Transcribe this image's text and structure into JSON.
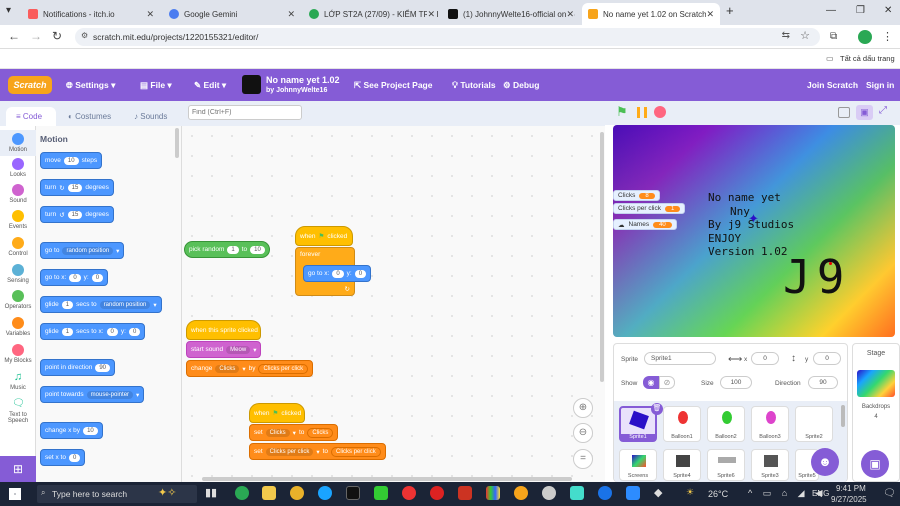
{
  "browser": {
    "tabs": [
      {
        "title": "Notifications - itch.io",
        "color": "#fa5c5c"
      },
      {
        "title": "Google Gemini",
        "color": "#4a7cf0"
      },
      {
        "title": "LỚP ST2A (27/09) - KIỂM TRA I",
        "color": "#2aa854"
      },
      {
        "title": "(1) JohnnyWelte16-official on G",
        "color": "#111111"
      },
      {
        "title": "No name yet 1.02 on Scratch",
        "color": "#f7a41b"
      }
    ],
    "url": "scratch.mit.edu/projects/1220155321/editor/",
    "bookmarks_folder": "Tất cả dấu trang"
  },
  "menubar": {
    "logo": "Scratch",
    "settings": "Settings",
    "file": "File",
    "edit": "Edit",
    "project_title": "No name yet 1.02",
    "project_author": "by JohnnyWelte16",
    "see_project_page": "See Project Page",
    "tutorials": "Tutorials",
    "debug": "Debug",
    "join": "Join Scratch",
    "signin": "Sign in"
  },
  "editor_tabs": {
    "code": "Code",
    "costumes": "Costumes",
    "sounds": "Sounds"
  },
  "find": {
    "placeholder": "Find (Ctrl+F)"
  },
  "categories": [
    {
      "label": "Motion",
      "color": "#4c97ff"
    },
    {
      "label": "Looks",
      "color": "#9966ff"
    },
    {
      "label": "Sound",
      "color": "#cf63cf"
    },
    {
      "label": "Events",
      "color": "#ffbf00"
    },
    {
      "label": "Control",
      "color": "#ffab19"
    },
    {
      "label": "Sensing",
      "color": "#5cb1d6"
    },
    {
      "label": "Operators",
      "color": "#59c059"
    },
    {
      "label": "Variables",
      "color": "#ff8c1a"
    },
    {
      "label": "My Blocks",
      "color": "#ff6680"
    },
    {
      "label": "Music",
      "color": "#0fbd8c"
    },
    {
      "label": "Text to Speech",
      "color": "#0fbd8c"
    }
  ],
  "palette": {
    "heading": "Motion",
    "move": {
      "a": "move",
      "v": "10",
      "b": "steps"
    },
    "turn_r": {
      "a": "turn",
      "v": "15",
      "b": "degrees"
    },
    "turn_l": {
      "a": "turn",
      "v": "15",
      "b": "degrees"
    },
    "goto": {
      "a": "go to",
      "dd": "random position"
    },
    "gotoxy": {
      "a": "go to x:",
      "x": "0",
      "b": "y:",
      "y": "0"
    },
    "glide1": {
      "a": "glide",
      "v": "1",
      "b": "secs to",
      "dd": "random position"
    },
    "glide2": {
      "a": "glide",
      "v": "1",
      "b": "secs to x:",
      "x": "0",
      "c": "y:",
      "y": "0"
    },
    "point_dir": {
      "a": "point in direction",
      "v": "90"
    },
    "point_towards": {
      "a": "point towards",
      "dd": "mouse-pointer"
    },
    "change_x": {
      "a": "change x by",
      "v": "10"
    },
    "set_x": {
      "a": "set x to",
      "v": "0"
    }
  },
  "scripts": {
    "pick": {
      "a": "pick random",
      "v1": "1",
      "b": "to",
      "v2": "10"
    },
    "s1": {
      "hat": "when",
      "hat2": "clicked",
      "forever": "forever",
      "goto_a": "go to x:",
      "x": "0",
      "goto_b": "y:",
      "y": "0"
    },
    "s2": {
      "hat": "when this sprite clicked",
      "sound_a": "start sound",
      "sound_dd": "Meow",
      "change_a": "change",
      "change_dd": "Clicks",
      "change_b": "by",
      "change_v": "Clicks per click"
    },
    "s3": {
      "hat": "when",
      "hat2": "clicked",
      "set1_a": "set",
      "set1_dd": "Clicks",
      "set1_b": "to",
      "set1_v": "Clicks",
      "set2_a": "set",
      "set2_dd": "Clicks per click",
      "set2_b": "to",
      "set2_v": "Clicks per click"
    }
  },
  "stage": {
    "monitors": [
      {
        "label": "Clicks",
        "value": "8"
      },
      {
        "label": "Clicks per click",
        "value": "1"
      },
      {
        "label": "Names",
        "value": "40"
      }
    ],
    "text_lines": [
      "No name yet",
      "Nny",
      "By j9 Studios",
      "ENJOY",
      "Version 1.02"
    ],
    "signature": "J9"
  },
  "sprite_info": {
    "sprite_label": "Sprite",
    "sprite_name": "Sprite1",
    "x_label": "x",
    "x": "0",
    "y_label": "y",
    "y": "0",
    "show_label": "Show",
    "size_label": "Size",
    "size": "100",
    "direction_label": "Direction",
    "direction": "90"
  },
  "sprites": [
    {
      "name": "Sprite1",
      "selected": true
    },
    {
      "name": "Balloon1"
    },
    {
      "name": "Balloon2"
    },
    {
      "name": "Balloon3"
    },
    {
      "name": "Sprite2"
    },
    {
      "name": "Screens"
    },
    {
      "name": "Sprite4"
    },
    {
      "name": "Sprite6"
    },
    {
      "name": "Sprite3"
    },
    {
      "name": "Sprite5"
    }
  ],
  "stage_panel": {
    "title": "Stage",
    "backdrops_label": "Backdrops",
    "backdrops_count": "4"
  },
  "taskbar": {
    "search": "Type here to search",
    "weather": "26°C",
    "lang": "ENG",
    "time": "9:41 PM",
    "date": "9/27/2025"
  }
}
